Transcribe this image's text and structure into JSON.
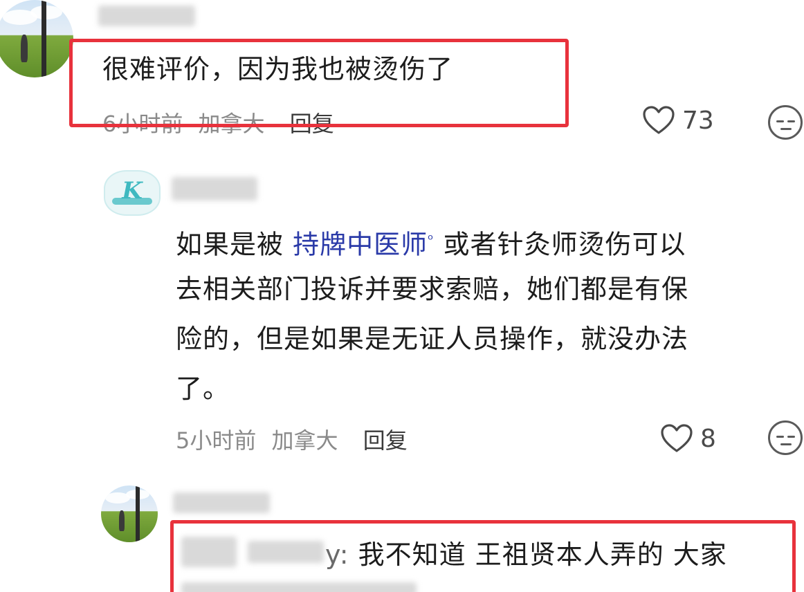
{
  "comments": [
    {
      "text": "很难评价，因为我也被烫伤了",
      "time": "6小时前",
      "location": "加拿大",
      "reply_label": "回复",
      "likes": "73"
    },
    {
      "text_before_link": "如果是被 ",
      "link_text": "持牌中医师",
      "text_line1_after_link": " 或者针灸师烫伤可以",
      "text_line2": "去相关部门投诉并要求索赔，她们都是有保",
      "text_line3": "险的，但是如果是无证人员操作，就没办法",
      "text_line4": "了。",
      "time": "5小时前",
      "location": "加拿大",
      "reply_label": "回复",
      "likes": "8"
    },
    {
      "username_suffix": "y:",
      "text": "我不知道 王祖贤本人弄的 大家"
    }
  ],
  "colors": {
    "highlight": "#e8323c",
    "link": "#2a3aa8"
  },
  "icons": {
    "like": "heart-outline-icon",
    "reaction": "neutral-face-icon",
    "link_search": "search-icon"
  }
}
